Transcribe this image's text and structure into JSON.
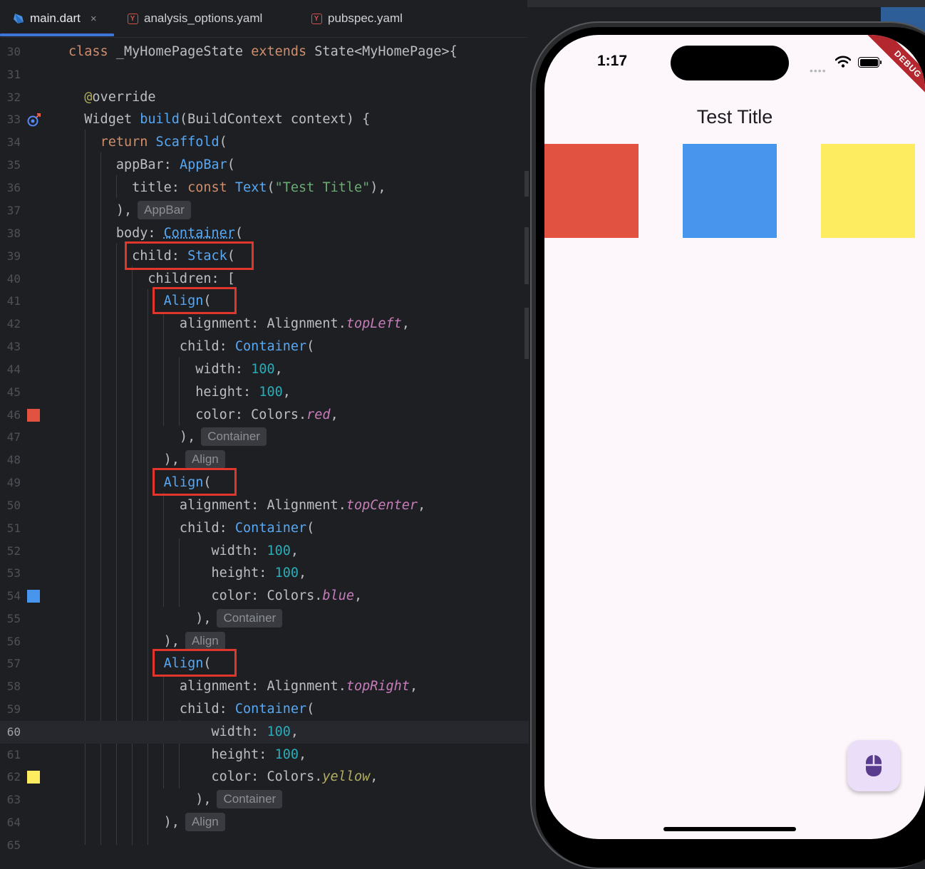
{
  "tabs": [
    {
      "name": "main.dart",
      "active": true
    },
    {
      "name": "analysis_options.yaml",
      "active": false
    },
    {
      "name": "pubspec.yaml",
      "active": false
    }
  ],
  "tab_close_glyph": "×",
  "editor": {
    "current_line": 60,
    "lines": [
      {
        "n": "30"
      },
      {
        "n": "31"
      },
      {
        "n": "32"
      },
      {
        "n": "33"
      },
      {
        "n": "34"
      },
      {
        "n": "35"
      },
      {
        "n": "36"
      },
      {
        "n": "37"
      },
      {
        "n": "38"
      },
      {
        "n": "39"
      },
      {
        "n": "40"
      },
      {
        "n": "41"
      },
      {
        "n": "42"
      },
      {
        "n": "43"
      },
      {
        "n": "44"
      },
      {
        "n": "45"
      },
      {
        "n": "46"
      },
      {
        "n": "47"
      },
      {
        "n": "48"
      },
      {
        "n": "49"
      },
      {
        "n": "50"
      },
      {
        "n": "51"
      },
      {
        "n": "52"
      },
      {
        "n": "53"
      },
      {
        "n": "54"
      },
      {
        "n": "55"
      },
      {
        "n": "56"
      },
      {
        "n": "57"
      },
      {
        "n": "58"
      },
      {
        "n": "59"
      },
      {
        "n": "60"
      },
      {
        "n": "61"
      },
      {
        "n": "62"
      },
      {
        "n": "63"
      },
      {
        "n": "64"
      },
      {
        "n": "65"
      }
    ],
    "hints": {
      "appbar": "AppBar",
      "container": "Container",
      "align": "Align"
    },
    "gutter_colors": {
      "red": "#e15241",
      "blue": "#4795ed",
      "yellow": "#fdeb60"
    },
    "highlight_color": "#e0362c"
  },
  "phone": {
    "time": "1:17",
    "debug_label": "DEBUG",
    "app_title": "Test Title",
    "boxes": [
      {
        "name": "red",
        "color": "#e15241"
      },
      {
        "name": "blue",
        "color": "#4795ed"
      },
      {
        "name": "yellow",
        "color": "#fdeb60"
      }
    ],
    "fab_icon": "mouse-icon",
    "fab_color": "#ebdef9"
  }
}
